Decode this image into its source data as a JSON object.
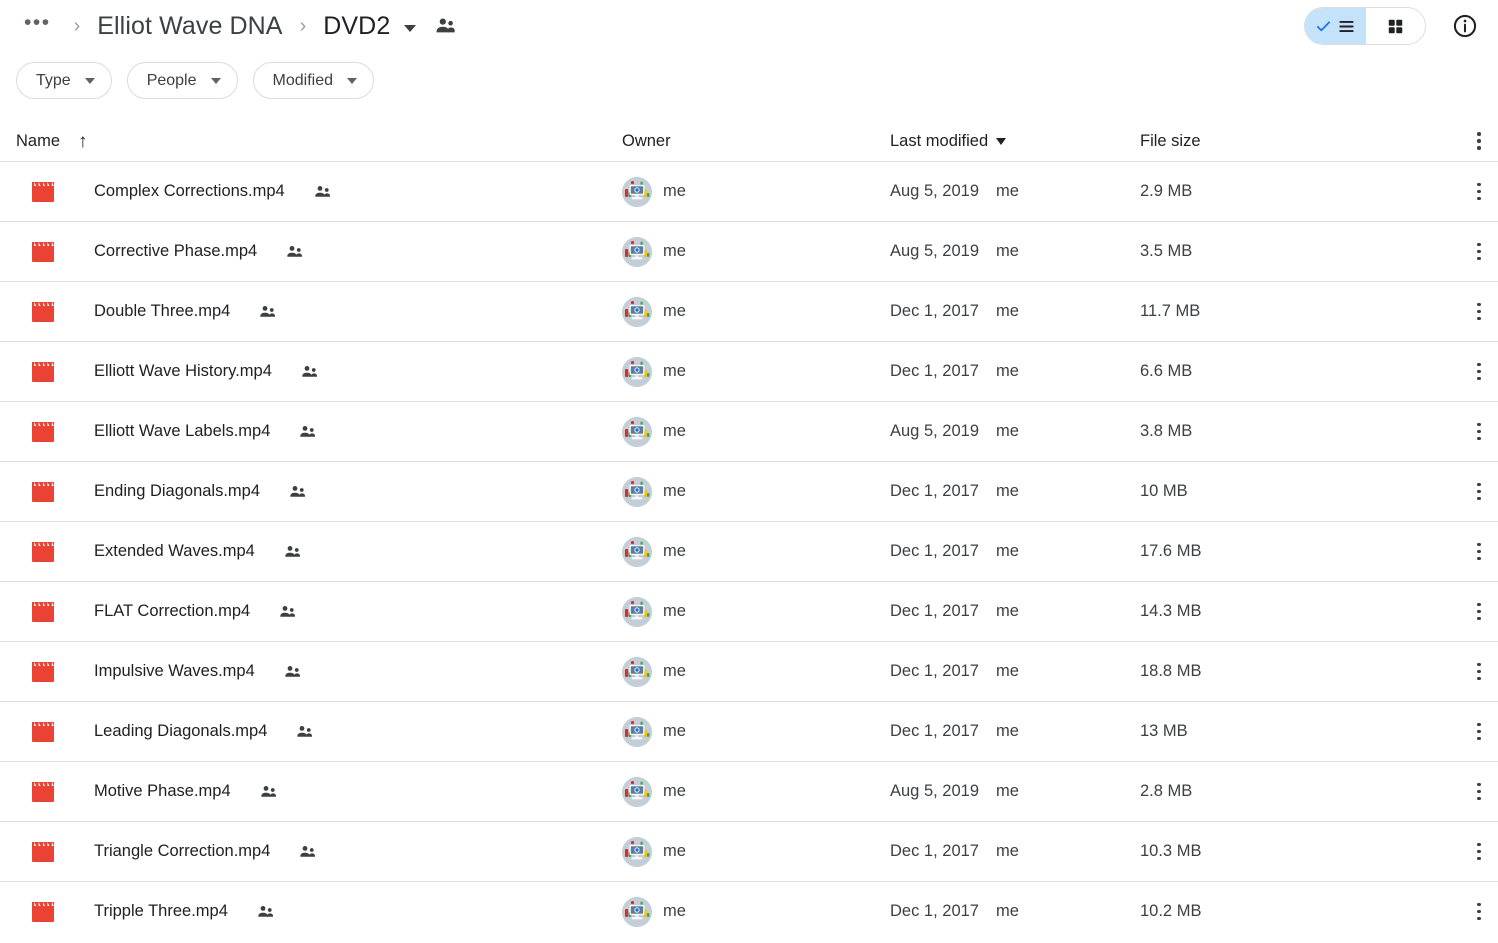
{
  "topbar": {
    "breadcrumb": {
      "overflow": "•••",
      "separator": "›",
      "parent": "Elliot Wave DNA",
      "current": "DVD2"
    },
    "people_icon": "people-shared-icon",
    "view_toggle": {
      "list_label": "list-view",
      "grid_label": "grid-view",
      "active": "list"
    },
    "info_label": "info-icon"
  },
  "filters": [
    {
      "label": "Type"
    },
    {
      "label": "People"
    },
    {
      "label": "Modified"
    }
  ],
  "columns": {
    "name": "Name",
    "name_sort": "↑",
    "owner": "Owner",
    "modified": "Last modified",
    "size": "File size"
  },
  "colors": {
    "video_icon": "#ea4335",
    "toggle_active": "#c5e2fb",
    "border": "#e0e0e0",
    "text_primary": "#202124",
    "text_secondary": "#3c4043"
  },
  "files": [
    {
      "name": "Complex Corrections.mp4",
      "shared": true,
      "owner": "me",
      "modified": "Aug 5, 2019",
      "modified_by": "me",
      "size": "2.9 MB"
    },
    {
      "name": "Corrective Phase.mp4",
      "shared": true,
      "owner": "me",
      "modified": "Aug 5, 2019",
      "modified_by": "me",
      "size": "3.5 MB"
    },
    {
      "name": "Double Three.mp4",
      "shared": true,
      "owner": "me",
      "modified": "Dec 1, 2017",
      "modified_by": "me",
      "size": "11.7 MB"
    },
    {
      "name": "Elliott Wave History.mp4",
      "shared": true,
      "owner": "me",
      "modified": "Dec 1, 2017",
      "modified_by": "me",
      "size": "6.6 MB"
    },
    {
      "name": "Elliott Wave Labels.mp4",
      "shared": true,
      "owner": "me",
      "modified": "Aug 5, 2019",
      "modified_by": "me",
      "size": "3.8 MB"
    },
    {
      "name": "Ending Diagonals.mp4",
      "shared": true,
      "owner": "me",
      "modified": "Dec 1, 2017",
      "modified_by": "me",
      "size": "10 MB"
    },
    {
      "name": "Extended Waves.mp4",
      "shared": true,
      "owner": "me",
      "modified": "Dec 1, 2017",
      "modified_by": "me",
      "size": "17.6 MB"
    },
    {
      "name": "FLAT Correction.mp4",
      "shared": true,
      "owner": "me",
      "modified": "Dec 1, 2017",
      "modified_by": "me",
      "size": "14.3 MB"
    },
    {
      "name": "Impulsive Waves.mp4",
      "shared": true,
      "owner": "me",
      "modified": "Dec 1, 2017",
      "modified_by": "me",
      "size": "18.8 MB"
    },
    {
      "name": "Leading Diagonals.mp4",
      "shared": true,
      "owner": "me",
      "modified": "Dec 1, 2017",
      "modified_by": "me",
      "size": "13 MB"
    },
    {
      "name": "Motive Phase.mp4",
      "shared": true,
      "owner": "me",
      "modified": "Aug 5, 2019",
      "modified_by": "me",
      "size": "2.8 MB"
    },
    {
      "name": "Triangle Correction.mp4",
      "shared": true,
      "owner": "me",
      "modified": "Dec 1, 2017",
      "modified_by": "me",
      "size": "10.3 MB"
    },
    {
      "name": "Tripple Three.mp4",
      "shared": true,
      "owner": "me",
      "modified": "Dec 1, 2017",
      "modified_by": "me",
      "size": "10.2 MB"
    }
  ]
}
